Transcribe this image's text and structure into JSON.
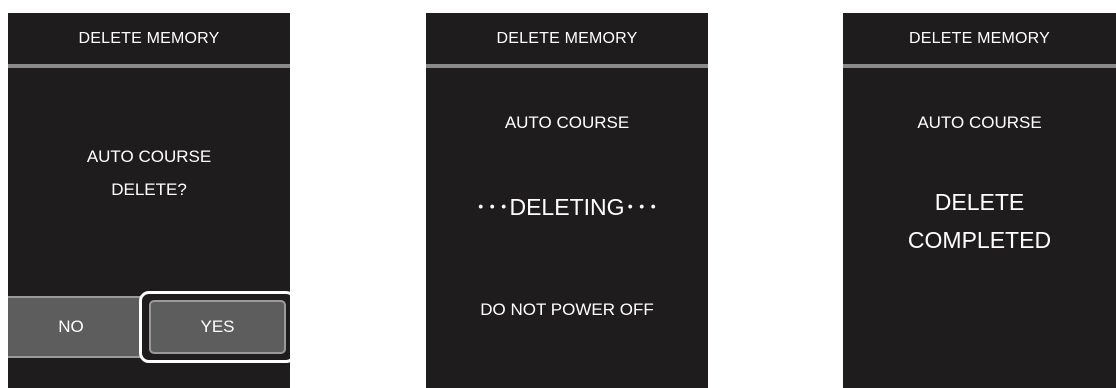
{
  "screens": [
    {
      "header": "DELETE MEMORY",
      "message_line1": "AUTO COURSE",
      "message_line2": "DELETE?",
      "buttons": {
        "no": "NO",
        "yes": "YES"
      }
    },
    {
      "header": "DELETE MEMORY",
      "course": "AUTO COURSE",
      "status": "･･･DELETING･･･",
      "warning": "DO NOT POWER OFF"
    },
    {
      "header": "DELETE MEMORY",
      "course": "AUTO COURSE",
      "status_line1": "DELETE",
      "status_line2": "COMPLETED"
    }
  ],
  "colors": {
    "screen_background": "#1e1c1c",
    "divider": "#8a8a8a",
    "button_fill": "#5e5d5d",
    "text": "#ffffff"
  }
}
